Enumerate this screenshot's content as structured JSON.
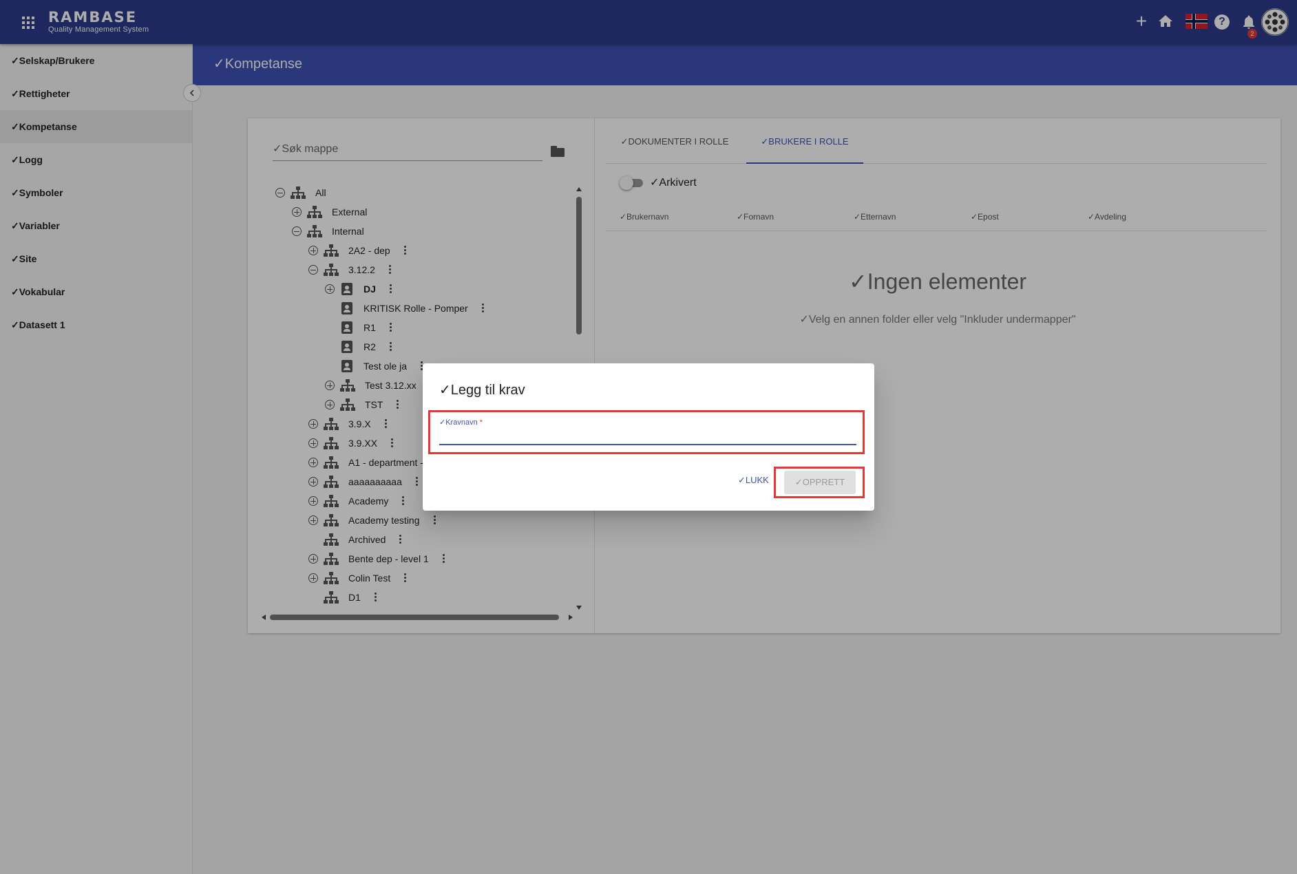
{
  "header": {
    "logo_main": "RAMBASE",
    "logo_sub": "Quality Management System",
    "notification_count": "2",
    "flag_icon": "norway-flag-icon"
  },
  "sidebar": {
    "items": [
      {
        "label": "✓Selskap/Brukere"
      },
      {
        "label": "✓Rettigheter"
      },
      {
        "label": "✓Kompetanse",
        "active": true
      },
      {
        "label": "✓Logg"
      },
      {
        "label": "✓Symboler"
      },
      {
        "label": "✓Variabler"
      },
      {
        "label": "✓Site"
      },
      {
        "label": "✓Vokabular"
      },
      {
        "label": "✓Datasett 1"
      }
    ]
  },
  "page": {
    "title": "✓Kompetanse"
  },
  "folder_panel": {
    "search_placeholder": "✓Søk mappe",
    "tree": [
      {
        "label": "All",
        "expanded": true
      },
      {
        "label": "External",
        "expandable": true
      },
      {
        "label": "Internal",
        "expanded": true
      },
      {
        "label": "2A2 - dep"
      },
      {
        "label": "3.12.2"
      },
      {
        "label": "DJ"
      },
      {
        "label": "KRITISK Rolle - Pomper"
      },
      {
        "label": "R1"
      },
      {
        "label": "R2"
      },
      {
        "label": "Test ole ja"
      },
      {
        "label": "Test 3.12.xx"
      },
      {
        "label": "TST"
      },
      {
        "label": "3.9.X"
      },
      {
        "label": "3.9.XX"
      },
      {
        "label": "A1 - department -"
      },
      {
        "label": "aaaaaaaaaa"
      },
      {
        "label": "Academy"
      },
      {
        "label": "Academy testing"
      },
      {
        "label": "Archived"
      },
      {
        "label": "Bente dep - level 1"
      },
      {
        "label": "Colin Test"
      },
      {
        "label": "D1"
      }
    ]
  },
  "role_panel": {
    "tabs": [
      "✓DOKUMENTER I ROLLE",
      "✓BRUKERE I ROLLE"
    ],
    "active_tab": "✓BRUKERE I ROLLE",
    "archived_label": "✓Arkivert",
    "archived_on": false,
    "columns": [
      "✓Brukernavn",
      "✓Fornavn",
      "✓Etternavn",
      "✓Epost",
      "✓Avdeling"
    ],
    "empty_title": "✓Ingen elementer",
    "empty_subtitle": "✓Velg en annen folder eller velg \"Inkluder undermapper\""
  },
  "dialog": {
    "title": "✓Legg til krav",
    "field_label": "✓Kravnavn",
    "field_required_marker": "*",
    "field_value": "",
    "close_label": "✓LUKK",
    "create_label": "✓OPPRETT",
    "highlight_color": "#e53935"
  },
  "colors": {
    "topbar": "#2e3a8c",
    "page_header": "#3f51b5",
    "accent": "#3f51b5"
  }
}
